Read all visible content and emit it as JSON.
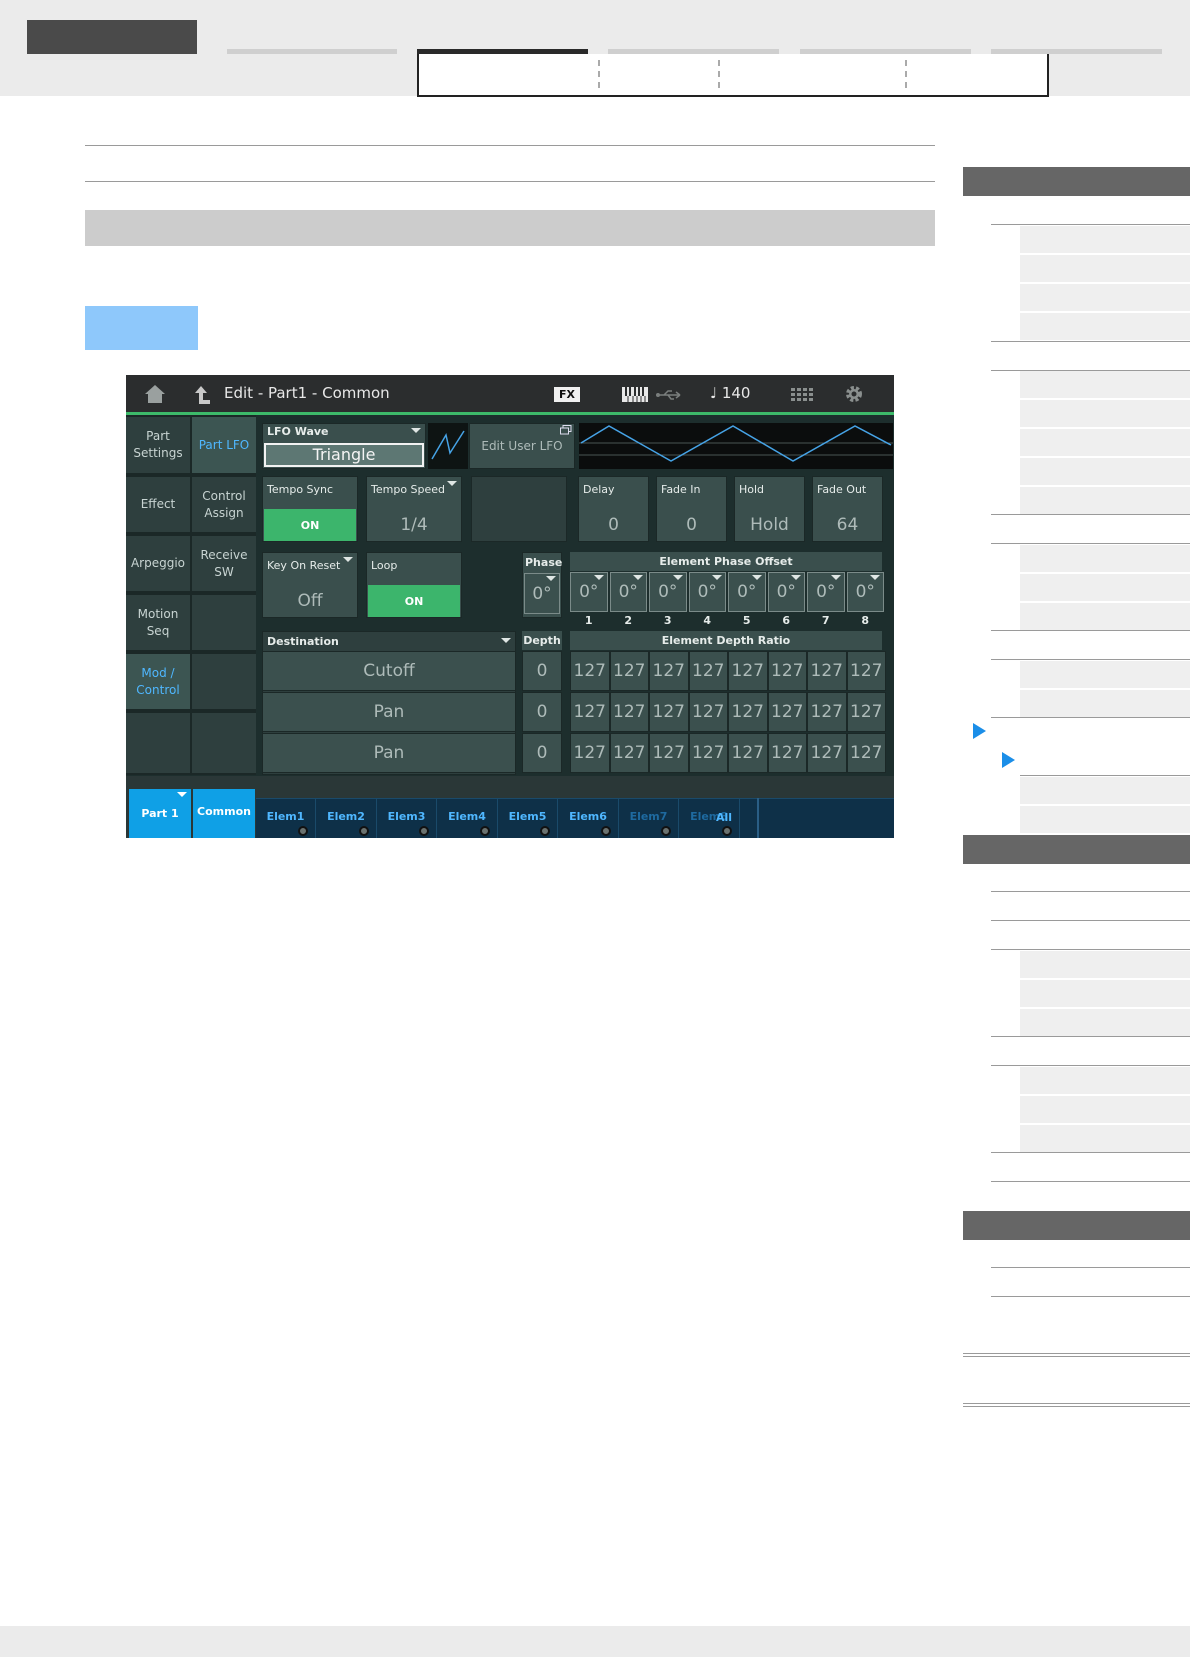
{
  "screen": {
    "header": {
      "title": "Edit - Part1 - Common",
      "fx_badge": "FX",
      "tempo": "♩ 140",
      "icons": [
        "home-icon",
        "back-arrow-icon",
        "keyboard-icon",
        "usb-icon",
        "grid-icon",
        "gear-icon"
      ]
    },
    "left_tabs": [
      {
        "label": "Part Settings"
      },
      {
        "label": "Effect"
      },
      {
        "label": "Arpeggio"
      },
      {
        "label": "Motion Seq"
      },
      {
        "label": "Mod / Control"
      }
    ],
    "sub_tabs": [
      {
        "label": "Part LFO"
      },
      {
        "label": "Control Assign"
      },
      {
        "label": "Receive SW"
      }
    ],
    "lfo_wave": {
      "label": "LFO Wave",
      "value": "Triangle"
    },
    "edit_user_lfo": "Edit User LFO",
    "tempo_sync": {
      "label": "Tempo Sync",
      "value": "ON"
    },
    "tempo_speed": {
      "label": "Tempo Speed",
      "value": "1/4"
    },
    "delay": {
      "label": "Delay",
      "value": "0"
    },
    "fade_in": {
      "label": "Fade In",
      "value": "0"
    },
    "hold": {
      "label": "Hold",
      "value": "Hold"
    },
    "fade_out": {
      "label": "Fade Out",
      "value": "64"
    },
    "key_on_reset": {
      "label": "Key On Reset",
      "value": "Off"
    },
    "loop": {
      "label": "Loop",
      "value": "ON"
    },
    "phase": {
      "label": "Phase",
      "value": "0°"
    },
    "element_phase_offset": {
      "label": "Element Phase Offset",
      "values": [
        "0°",
        "0°",
        "0°",
        "0°",
        "0°",
        "0°",
        "0°",
        "0°"
      ],
      "numbers": [
        "1",
        "2",
        "3",
        "4",
        "5",
        "6",
        "7",
        "8"
      ]
    },
    "destination": {
      "label": "Destination",
      "rows": [
        {
          "name": "Cutoff",
          "depth": "0",
          "ratios": [
            "127",
            "127",
            "127",
            "127",
            "127",
            "127",
            "127",
            "127"
          ]
        },
        {
          "name": "Pan",
          "depth": "0",
          "ratios": [
            "127",
            "127",
            "127",
            "127",
            "127",
            "127",
            "127",
            "127"
          ]
        },
        {
          "name": "Pan",
          "depth": "0",
          "ratios": [
            "127",
            "127",
            "127",
            "127",
            "127",
            "127",
            "127",
            "127"
          ]
        }
      ]
    },
    "depth_label": "Depth",
    "element_depth_ratio_label": "Element Depth Ratio",
    "bottom_tabs": {
      "part": "Part 1",
      "common": "Common",
      "elements": [
        "Elem1",
        "Elem2",
        "Elem3",
        "Elem4",
        "Elem5",
        "Elem6",
        "Elem7",
        "Elem8"
      ],
      "all": "All"
    }
  }
}
